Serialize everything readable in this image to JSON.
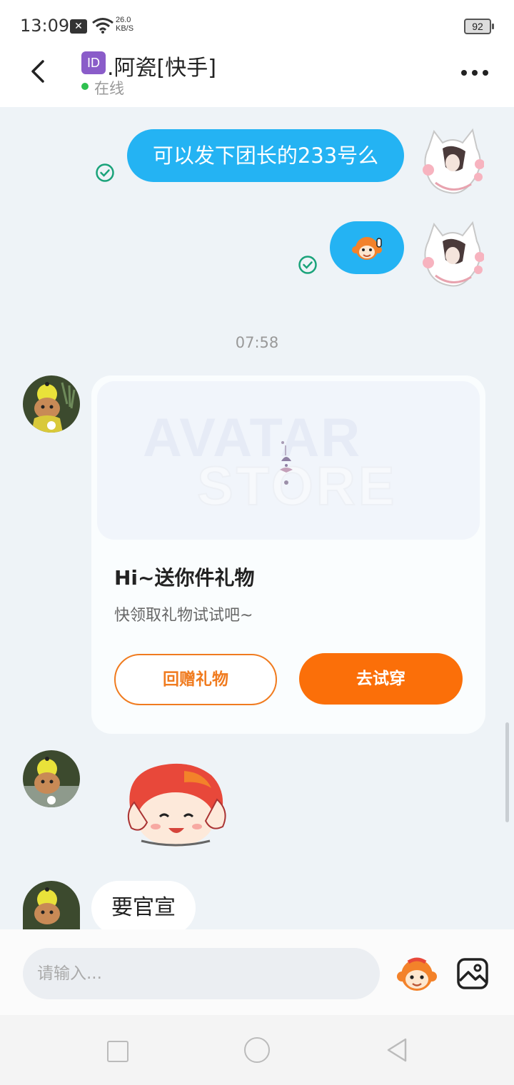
{
  "status_bar": {
    "time": "13:09",
    "notification_icon": "x-box-icon",
    "net_speed_value": "26.0",
    "net_speed_unit": "KB/S",
    "battery": "92"
  },
  "header": {
    "id_badge": "ID",
    "title": ".阿瓷[快手]",
    "presence": "在线"
  },
  "messages": {
    "sent_text": "可以发下团长的233号么",
    "timestamp": "07:58",
    "gift_card": {
      "banner_line1": "AVATAR",
      "banner_line2": "STORE",
      "title": "Hi~送你件礼物",
      "subtitle": "快领取礼物试试吧~",
      "return_gift_label": "回赠礼物",
      "try_on_label": "去试穿"
    },
    "received_text": "要官宣"
  },
  "composer": {
    "placeholder": "请输入..."
  },
  "colors": {
    "sent_bubble": "#24b3f3",
    "accent_orange": "#fb6f09",
    "read_check": "#1aa37a",
    "online": "#2ec04f"
  }
}
